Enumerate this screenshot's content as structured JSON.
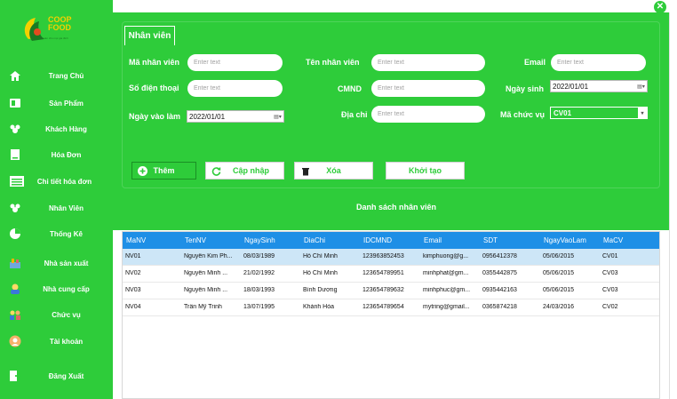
{
  "window": {
    "close_icon": "close-icon"
  },
  "logo": {
    "text_line1": "COOP",
    "text_line2": "FOOD",
    "tagline": "an toàn cho mọi gia đình"
  },
  "sidebar": {
    "items": [
      {
        "label": "Trang Chủ",
        "icon": "home-icon"
      },
      {
        "label": "Sản Phẩm",
        "icon": "product-icon"
      },
      {
        "label": "Khách Hàng",
        "icon": "customers-icon"
      },
      {
        "label": "Hóa Đơn",
        "icon": "invoice-icon"
      },
      {
        "label": "Chi tiết hóa đơn",
        "icon": "invoice-detail-icon"
      },
      {
        "label": "Nhân Viên",
        "icon": "employees-icon"
      },
      {
        "label": "Thống Kê",
        "icon": "pie-chart-icon"
      },
      {
        "label": "Nhà sản xuất",
        "icon": "manufacturer-icon"
      },
      {
        "label": "Nhà cung cấp",
        "icon": "supplier-icon"
      },
      {
        "label": "Chức vụ",
        "icon": "position-icon"
      },
      {
        "label": "Tài khoản",
        "icon": "account-icon"
      },
      {
        "label": "Đăng Xuất",
        "icon": "logout-icon"
      }
    ]
  },
  "form": {
    "tab_label": "Nhân viên",
    "ma_nv_label": "Mã nhân viên",
    "ten_nv_label": "Tên nhân viên",
    "email_label": "Email",
    "sdt_label": "Số điện thoại",
    "cmnd_label": "CMND",
    "ngay_sinh_label": "Ngày sinh",
    "ngay_vao_lam_label": "Ngày vào làm",
    "dia_chi_label": "Địa chỉ",
    "ma_chuc_vu_label": "Mã chức vụ",
    "placeholder": "Enter text",
    "ngay_sinh_value": "2022/01/01",
    "ngay_vao_lam_value": "2022/01/01",
    "ma_chuc_vu_value": "CV01"
  },
  "actions": {
    "add": "Thêm",
    "update": "Cập nhập",
    "delete": "Xóa",
    "reset": "Khởi tạo",
    "list": "Danh sách nhân viên"
  },
  "table": {
    "columns": [
      "MaNV",
      "TenNV",
      "NgaySinh",
      "DiaChi",
      "IDCMND",
      "Email",
      "SDT",
      "NgayVaoLam",
      "MaCV"
    ],
    "rows": [
      [
        "NV01",
        "Nguyễn Kim Ph...",
        "08/03/1989",
        "Hồ Chí Minh",
        "123963852453",
        "kimphuong@g...",
        "0956412378",
        "05/06/2015",
        "CV01"
      ],
      [
        "NV02",
        "Nguyễn Minh ...",
        "21/02/1992",
        "Hồ Chí Minh",
        "123654789951",
        "minhphat@gm...",
        "0355442875",
        "05/06/2015",
        "CV03"
      ],
      [
        "NV03",
        "Nguyễn Minh ...",
        "18/03/1993",
        "Bình Dương",
        "123654789632",
        "minhphuc@gm...",
        "0935442163",
        "05/06/2015",
        "CV03"
      ],
      [
        "NV04",
        "Trần Mỹ Trinh",
        "13/07/1995",
        "Khánh Hòa",
        "123654789654",
        "mytring@gmail...",
        "0365874218",
        "24/03/2016",
        "CV02"
      ]
    ]
  },
  "colors": {
    "accent": "#2ecc3a",
    "header": "#1e8fe6",
    "selected": "#cde6f7"
  }
}
